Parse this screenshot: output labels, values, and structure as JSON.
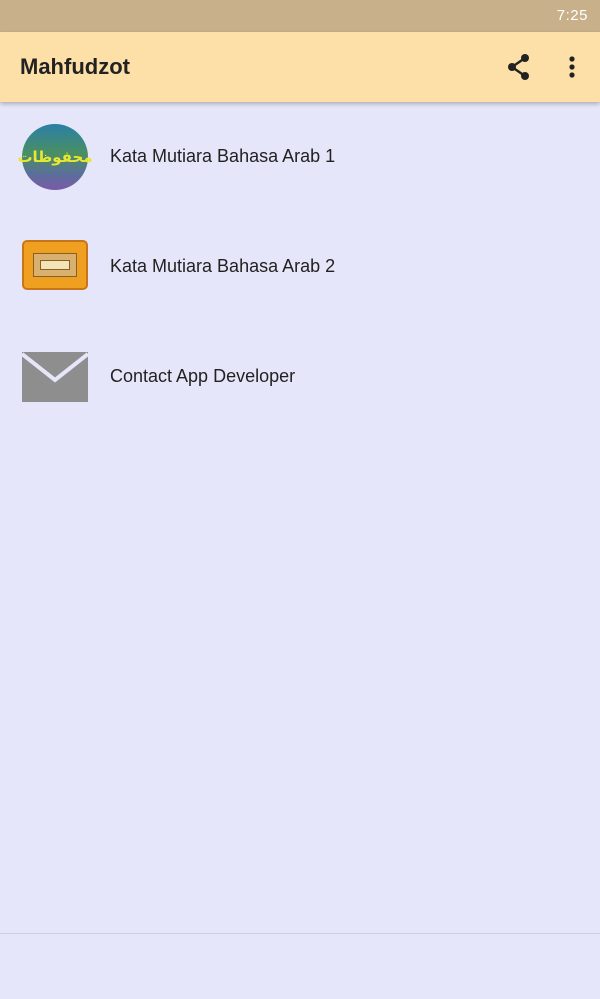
{
  "status_bar": {
    "time": "7:25"
  },
  "app_bar": {
    "title": "Mahfudzot",
    "actions": [
      {
        "icon": "share-icon"
      },
      {
        "icon": "more-vert-icon"
      }
    ]
  },
  "list": {
    "items": [
      {
        "label": "Kata Mutiara Bahasa Arab 1",
        "icon": "mahfudzot-arabic-icon",
        "icon_text": "محفوظات"
      },
      {
        "label": "Kata Mutiara Bahasa Arab 2",
        "icon": "book-box-icon"
      },
      {
        "label": "Contact App Developer",
        "icon": "mail-icon"
      }
    ]
  },
  "colors": {
    "status_bar": "#c8b08a",
    "app_bar": "#fddfa8",
    "background": "#e6e6fa"
  }
}
